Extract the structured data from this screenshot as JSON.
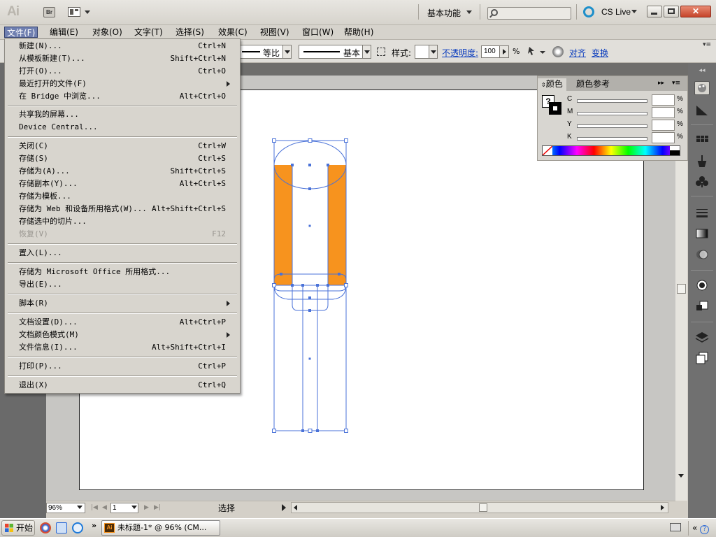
{
  "app": {
    "logo": "Ai",
    "bridge_label": "Br",
    "workspace_label": "基本功能",
    "search_placeholder": "",
    "cslive_label": "CS Live"
  },
  "menubar": {
    "items": [
      "文件(F)",
      "编辑(E)",
      "对象(O)",
      "文字(T)",
      "选择(S)",
      "效果(C)",
      "视图(V)",
      "窗口(W)",
      "帮助(H)"
    ],
    "active_index": 0
  },
  "controlbar": {
    "stroke_ratio": "等比",
    "stroke_style": "基本",
    "style_label": "样式:",
    "opacity_label": "不透明度:",
    "opacity_value": "100",
    "opacity_unit": "%",
    "align_label": "对齐",
    "transform_label": "变换"
  },
  "file_menu": {
    "items": [
      {
        "label": "新建(N)...",
        "shortcut": "Ctrl+N"
      },
      {
        "label": "从模板新建(T)...",
        "shortcut": "Shift+Ctrl+N"
      },
      {
        "label": "打开(O)...",
        "shortcut": "Ctrl+O"
      },
      {
        "label": "最近打开的文件(F)",
        "shortcut": "",
        "submenu": true
      },
      {
        "label": "在 Bridge 中浏览...",
        "shortcut": "Alt+Ctrl+O"
      },
      {
        "label": "共享我的屏幕...",
        "shortcut": ""
      },
      {
        "label": "Device Central...",
        "shortcut": ""
      },
      {
        "label": "关闭(C)",
        "shortcut": "Ctrl+W"
      },
      {
        "label": "存储(S)",
        "shortcut": "Ctrl+S"
      },
      {
        "label": "存储为(A)...",
        "shortcut": "Shift+Ctrl+S"
      },
      {
        "label": "存储副本(Y)...",
        "shortcut": "Alt+Ctrl+S"
      },
      {
        "label": "存储为模板...",
        "shortcut": ""
      },
      {
        "label": "存储为 Web 和设备所用格式(W)...",
        "shortcut": "Alt+Shift+Ctrl+S"
      },
      {
        "label": "存储选中的切片...",
        "shortcut": ""
      },
      {
        "label": "恢复(V)",
        "shortcut": "F12",
        "disabled": true
      },
      {
        "label": "置入(L)...",
        "shortcut": ""
      },
      {
        "label": "存储为 Microsoft Office 所用格式...",
        "shortcut": ""
      },
      {
        "label": "导出(E)...",
        "shortcut": ""
      },
      {
        "label": "脚本(R)",
        "shortcut": "",
        "submenu": true
      },
      {
        "label": "文档设置(D)...",
        "shortcut": "Alt+Ctrl+P"
      },
      {
        "label": "文档颜色模式(M)",
        "shortcut": "",
        "submenu": true
      },
      {
        "label": "文件信息(I)...",
        "shortcut": "Alt+Shift+Ctrl+I"
      },
      {
        "label": "打印(P)...",
        "shortcut": "Ctrl+P"
      },
      {
        "label": "退出(X)",
        "shortcut": "Ctrl+Q"
      }
    ]
  },
  "color_panel": {
    "tab_color": "颜色",
    "tab_guide": "颜色参考",
    "channels": [
      "C",
      "M",
      "Y",
      "K"
    ],
    "unit": "%"
  },
  "statusbar": {
    "zoom": "96%",
    "page": "1",
    "tool": "选择"
  },
  "taskbar": {
    "start": "开始",
    "task_label": "未标题-1* @ 96% (CM..."
  },
  "colors": {
    "orange_fill": "#f7931e",
    "selection_blue": "#4a72d8"
  }
}
